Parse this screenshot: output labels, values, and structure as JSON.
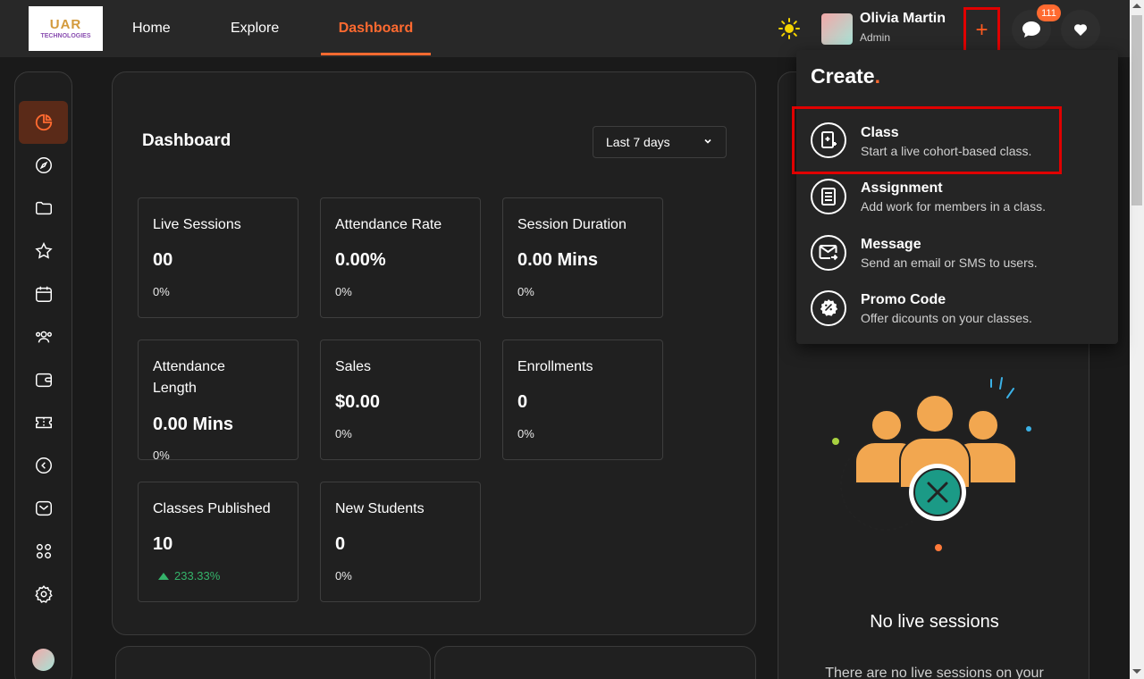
{
  "header": {
    "logo": {
      "line1": "UAR",
      "line2": "TECHNOLOGIES"
    },
    "nav": [
      {
        "label": "Home"
      },
      {
        "label": "Explore"
      },
      {
        "label": "Dashboard"
      }
    ],
    "user": {
      "name": "Olivia Martin",
      "role": "Admin"
    },
    "create_label": "+",
    "notification_count": "111"
  },
  "sidebar": {
    "items": [
      "chart-pie-icon",
      "compass-icon",
      "folder-icon",
      "star-icon",
      "calendar-icon",
      "users-icon",
      "wallet-icon",
      "ticket-icon",
      "arrow-left-circle-icon",
      "mail-icon",
      "apps-icon",
      "gear-icon"
    ]
  },
  "dashboard": {
    "title": "Dashboard",
    "range": "Last 7 days",
    "cards": [
      {
        "label": "Live Sessions",
        "value": "00",
        "change": "0%"
      },
      {
        "label": "Attendance Rate",
        "value": "0.00%",
        "change": "0%"
      },
      {
        "label": "Session Duration",
        "value": "0.00 Mins",
        "change": "0%"
      },
      {
        "label": "Attendance Length",
        "value": "0.00 Mins",
        "change": "0%"
      },
      {
        "label": "Sales",
        "value": "$0.00",
        "change": "0%"
      },
      {
        "label": "Enrollments",
        "value": "0",
        "change": "0%"
      },
      {
        "label": "Classes Published",
        "value": "10",
        "change": "233.33%"
      },
      {
        "label": "New Students",
        "value": "0",
        "change": "0%"
      }
    ]
  },
  "live_panel": {
    "empty_title": "No live sessions",
    "empty_sub": "There are no live sessions on your"
  },
  "create_menu": {
    "title": "Create",
    "title_dot": ".",
    "items": [
      {
        "label": "Class",
        "desc": "Start a live cohort-based class."
      },
      {
        "label": "Assignment",
        "desc": "Add work for members in a class."
      },
      {
        "label": "Message",
        "desc": "Send an email or SMS to users."
      },
      {
        "label": "Promo Code",
        "desc": "Offer dicounts on your classes."
      }
    ]
  },
  "colors": {
    "accent": "#ff6a30",
    "positive": "#35b36a",
    "highlight": "#e00000"
  }
}
